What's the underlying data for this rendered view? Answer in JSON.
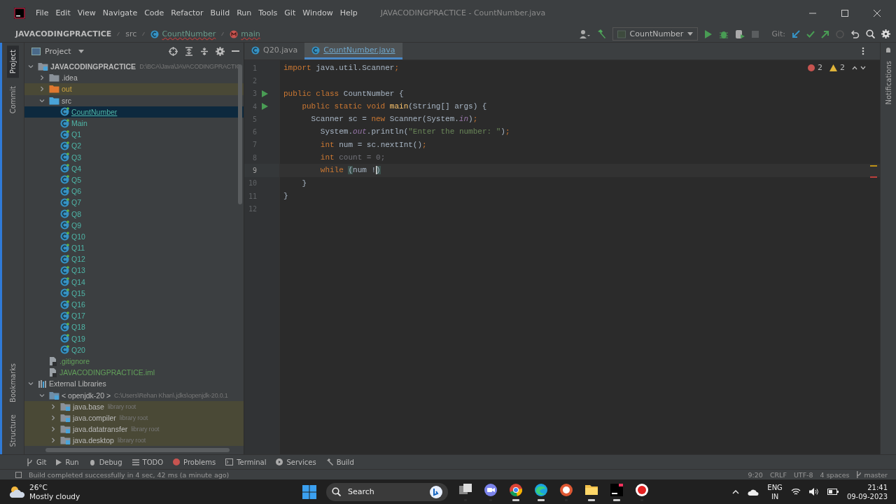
{
  "menu_bar": {
    "items": [
      "File",
      "Edit",
      "View",
      "Navigate",
      "Code",
      "Refactor",
      "Build",
      "Run",
      "Tools",
      "Git",
      "Window",
      "Help"
    ],
    "title": "JAVACODINGPRACTICE - CountNumber.java"
  },
  "breadcrumbs": [
    {
      "label": "JAVACODINGPRACTICE",
      "kind": "project"
    },
    {
      "label": "src",
      "kind": "folder"
    },
    {
      "label": "CountNumber",
      "kind": "class"
    },
    {
      "label": "main",
      "kind": "method"
    }
  ],
  "toolbar": {
    "run_config": "CountNumber",
    "git_label": "Git:"
  },
  "left_stripe": [
    {
      "label": "Project",
      "selected": true
    },
    {
      "label": "Commit",
      "selected": false
    }
  ],
  "left_stripe_bottom": [
    "Bookmarks",
    "Structure"
  ],
  "right_stripe": [
    "Notifications"
  ],
  "project_panel": {
    "title": "Project"
  },
  "project_tree": [
    {
      "name": "JAVACODINGPRACTICE",
      "hint": "D:\\BCA\\Java\\JAVACODINGPRACTIC",
      "kind": "module",
      "expanded": true,
      "selected": false,
      "children": [
        {
          "name": ".idea",
          "kind": "folder",
          "expanded": false,
          "selected": false
        },
        {
          "name": "out",
          "kind": "excluded",
          "expanded": false,
          "selected": false
        },
        {
          "name": "src",
          "kind": "source",
          "expanded": true,
          "selected": false,
          "children": [
            {
              "name": "CountNumber",
              "kind": "class",
              "selected": true
            },
            {
              "name": "Main",
              "kind": "class",
              "selected": false
            },
            {
              "name": "Q1",
              "kind": "class",
              "selected": false
            },
            {
              "name": "Q2",
              "kind": "class",
              "selected": false
            },
            {
              "name": "Q3",
              "kind": "class",
              "selected": false
            },
            {
              "name": "Q4",
              "kind": "class",
              "selected": false
            },
            {
              "name": "Q5",
              "kind": "class",
              "selected": false
            },
            {
              "name": "Q6",
              "kind": "class",
              "selected": false
            },
            {
              "name": "Q7",
              "kind": "class",
              "selected": false
            },
            {
              "name": "Q8",
              "kind": "class",
              "selected": false
            },
            {
              "name": "Q9",
              "kind": "class",
              "selected": false
            },
            {
              "name": "Q10",
              "kind": "class",
              "selected": false
            },
            {
              "name": "Q11",
              "kind": "class",
              "selected": false
            },
            {
              "name": "Q12",
              "kind": "class",
              "selected": false
            },
            {
              "name": "Q13",
              "kind": "class",
              "selected": false
            },
            {
              "name": "Q14",
              "kind": "class",
              "selected": false
            },
            {
              "name": "Q15",
              "kind": "class",
              "selected": false
            },
            {
              "name": "Q16",
              "kind": "class",
              "selected": false
            },
            {
              "name": "Q17",
              "kind": "class",
              "selected": false
            },
            {
              "name": "Q18",
              "kind": "class",
              "selected": false
            },
            {
              "name": "Q19",
              "kind": "class",
              "selected": false
            },
            {
              "name": "Q20",
              "kind": "class",
              "selected": false
            }
          ]
        },
        {
          "name": ".gitignore",
          "kind": "gitignore",
          "selected": false
        },
        {
          "name": "JAVACODINGPRACTICE.iml",
          "kind": "iml",
          "selected": false
        }
      ]
    },
    {
      "name": "External Libraries",
      "kind": "libraries",
      "expanded": true,
      "selected": false,
      "children": [
        {
          "name": "< openjdk-20 >",
          "hint": "C:\\Users\\Rehan Khan\\.jdks\\openjdk-20.0.1",
          "kind": "sdk",
          "expanded": true,
          "selected": false,
          "children": [
            {
              "name": "java.base",
              "hint": "library root",
              "kind": "library",
              "expanded": false,
              "selected": false
            },
            {
              "name": "java.compiler",
              "hint": "library root",
              "kind": "library",
              "expanded": false,
              "selected": false
            },
            {
              "name": "java.datatransfer",
              "hint": "library root",
              "kind": "library",
              "expanded": false,
              "selected": false
            },
            {
              "name": "java.desktop",
              "hint": "library root",
              "kind": "library",
              "expanded": false,
              "selected": false
            }
          ]
        }
      ]
    }
  ],
  "editor_tabs": [
    {
      "label": "Q20.java",
      "selected": false
    },
    {
      "label": "CountNumber.java",
      "selected": true
    }
  ],
  "inspections": {
    "errors": "2",
    "warnings": "2"
  },
  "code_lines": [
    {
      "number": "1",
      "run": false,
      "current": false,
      "tokens": [
        {
          "text": "import",
          "kind": "keyword"
        },
        {
          "text": " java.util.Scanner",
          "kind": "plain"
        },
        {
          "text": ";",
          "kind": "keyword"
        }
      ]
    },
    {
      "number": "2",
      "run": false,
      "current": false
    },
    {
      "number": "3",
      "run": true,
      "current": false,
      "tokens": [
        {
          "text": "public class",
          "kind": "keyword"
        },
        {
          "text": " CountNumber {",
          "kind": "plain"
        }
      ]
    },
    {
      "number": "4",
      "run": true,
      "current": false,
      "tokens": [
        {
          "text": "    public static void ",
          "kind": "keyword"
        },
        {
          "text": "main",
          "kind": "method"
        },
        {
          "text": "(String[] args) {",
          "kind": "plain"
        }
      ]
    },
    {
      "number": "5",
      "run": false,
      "current": false,
      "tokens": [
        {
          "text": "      Scanner sc = ",
          "kind": "plain"
        },
        {
          "text": "new",
          "kind": "keyword"
        },
        {
          "text": " Scanner(System.",
          "kind": "plain"
        },
        {
          "text": "in",
          "kind": "field"
        },
        {
          "text": ")",
          "kind": "plain"
        },
        {
          "text": ";",
          "kind": "keyword"
        }
      ]
    },
    {
      "number": "6",
      "run": false,
      "current": false,
      "tokens": [
        {
          "text": "        System.",
          "kind": "plain"
        },
        {
          "text": "out",
          "kind": "field"
        },
        {
          "text": ".println(",
          "kind": "plain"
        },
        {
          "text": "\"Enter the number: \"",
          "kind": "string"
        },
        {
          "text": ")",
          "kind": "plain"
        },
        {
          "text": ";",
          "kind": "keyword"
        }
      ]
    },
    {
      "number": "7",
      "run": false,
      "current": false,
      "tokens": [
        {
          "text": "        int",
          "kind": "keyword"
        },
        {
          "text": " num = sc.nextInt()",
          "kind": "plain"
        },
        {
          "text": ";",
          "kind": "keyword"
        }
      ]
    },
    {
      "number": "8",
      "run": false,
      "current": false,
      "tokens": [
        {
          "text": "        int",
          "kind": "keyword"
        },
        {
          "text": " count = 0;",
          "kind": "unused"
        }
      ]
    },
    {
      "number": "9",
      "run": false,
      "current": true,
      "tokens": [
        {
          "text": "        while ",
          "kind": "keyword"
        },
        {
          "text": "(",
          "kind": "match"
        },
        {
          "text": "num !",
          "kind": "plain"
        },
        {
          "text": ")",
          "kind": "match"
        }
      ]
    },
    {
      "number": "10",
      "run": false,
      "current": false,
      "tokens": [
        {
          "text": "    }",
          "kind": "plain"
        }
      ]
    },
    {
      "number": "11",
      "run": false,
      "current": false,
      "tokens": [
        {
          "text": "}",
          "kind": "plain"
        }
      ]
    },
    {
      "number": "12",
      "run": false,
      "current": false
    }
  ],
  "bottom_tabs": [
    {
      "label": "Git",
      "kind": "git"
    },
    {
      "label": "Run",
      "kind": "run"
    },
    {
      "label": "Debug",
      "kind": "debug"
    },
    {
      "label": "TODO",
      "kind": "todo"
    },
    {
      "label": "Problems",
      "kind": "problems"
    },
    {
      "label": "Terminal",
      "kind": "terminal"
    },
    {
      "label": "Services",
      "kind": "services"
    },
    {
      "label": "Build",
      "kind": "build"
    }
  ],
  "status_bar": {
    "message": "Build completed successfully in 4 sec, 42 ms (a minute ago)",
    "position": "9:20",
    "line_ending": "CRLF",
    "encoding": "UTF-8",
    "indent": "4 spaces",
    "branch": "master"
  },
  "taskbar": {
    "temperature": "26°C",
    "weather": "Mostly cloudy",
    "search_placeholder": "Search",
    "apps": [
      {
        "kind": "bing"
      },
      {
        "kind": "taskview",
        "active": false
      },
      {
        "kind": "chat",
        "active": false
      },
      {
        "kind": "chrome",
        "active": true
      },
      {
        "kind": "edge",
        "active": true
      },
      {
        "kind": "duck",
        "active": false
      },
      {
        "kind": "folder",
        "active": true
      },
      {
        "kind": "ide",
        "active": true
      },
      {
        "kind": "record",
        "active": false
      }
    ],
    "language": "ENG",
    "region": "IN",
    "time": "21:41",
    "date": "09-09-2023"
  }
}
